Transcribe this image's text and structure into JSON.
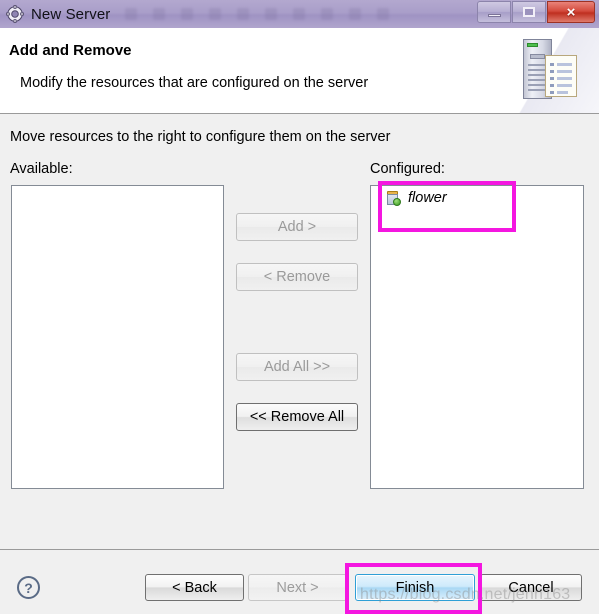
{
  "window": {
    "title": "New Server",
    "title_icon": "gear-icon",
    "controls": {
      "minimize": "minimize-icon",
      "maximize": "maximize-icon",
      "close": "×"
    }
  },
  "header": {
    "title": "Add and Remove",
    "subtitle": "Modify the resources that are configured on the server",
    "art_icon": "server-and-document-icon"
  },
  "body": {
    "instruction": "Move resources to the right to configure them on the server",
    "available": {
      "label": "Available:",
      "items": []
    },
    "configured": {
      "label": "Configured:",
      "items": [
        {
          "label": "flower",
          "icon": "web-module-icon"
        }
      ]
    },
    "transfer_buttons": [
      {
        "label": "Add >",
        "enabled": false
      },
      {
        "label": "< Remove",
        "enabled": false
      },
      {
        "label": "Add All >>",
        "enabled": false
      },
      {
        "label": "<< Remove All",
        "enabled": true
      }
    ]
  },
  "footer": {
    "help_icon": "?",
    "buttons": [
      {
        "label": "< Back",
        "state": "enabled"
      },
      {
        "label": "Next >",
        "state": "disabled"
      },
      {
        "label": "Finish",
        "state": "primary"
      },
      {
        "label": "Cancel",
        "state": "enabled"
      }
    ]
  },
  "annotations": {
    "highlight_color": "#f416e0",
    "regions": [
      "configured-item-flower",
      "finish-button"
    ]
  },
  "watermark": "https://blog.csdn.net/jenn163"
}
